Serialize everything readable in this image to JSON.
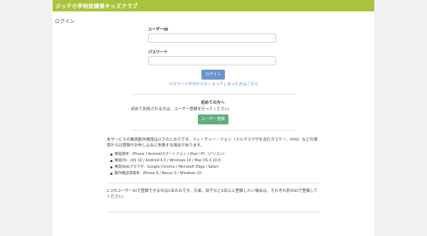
{
  "header": {
    "title": "ジッテ小学校放課後キッズクラブ"
  },
  "page_title": "ログイン",
  "form": {
    "user_id_label": "ユーザーID",
    "user_id_value": "",
    "password_label": "パスワード",
    "password_value": "",
    "login_button": "ログイン",
    "forgot_link": "パスワードが分からなくなってしまった方はこちら"
  },
  "first_time": {
    "title": "初めての方へ",
    "description": "初めて利用される方は、ユーザー登録を行ってください。",
    "register_button": "ユーザー登録"
  },
  "info": {
    "intro": "本サービスの推奨動作環境は以下のとおりです。フィーチャー・フォン（フルブラウザを含むガラケー、PHS）などの環境からは登録やお申し込みに失敗する場合があります。",
    "items": [
      "推奨端末：iPhone / Androidスマートフォン / iPad / PC（パソコン）",
      "推奨OS：iOS 10 / Android 6.0 / Windows 10 / Mac OS X 10.9",
      "推奨Webブラウザ：Google Chrome / Microsoft Edge / Safari",
      "動作確認済端末：iPhone 6 / Nexus 5 / Windows 10"
    ],
    "note": "1つのユーザーIDで登録できるのは1名のみです。兄弟、双子など2名以上登録したい場合は、それぞれ別のIDで登録してください。"
  },
  "colors": {
    "header_bg": "#a9c43c",
    "login_button": "#6a95cb",
    "register_button": "#5fae80",
    "link": "#5b8fc7"
  }
}
